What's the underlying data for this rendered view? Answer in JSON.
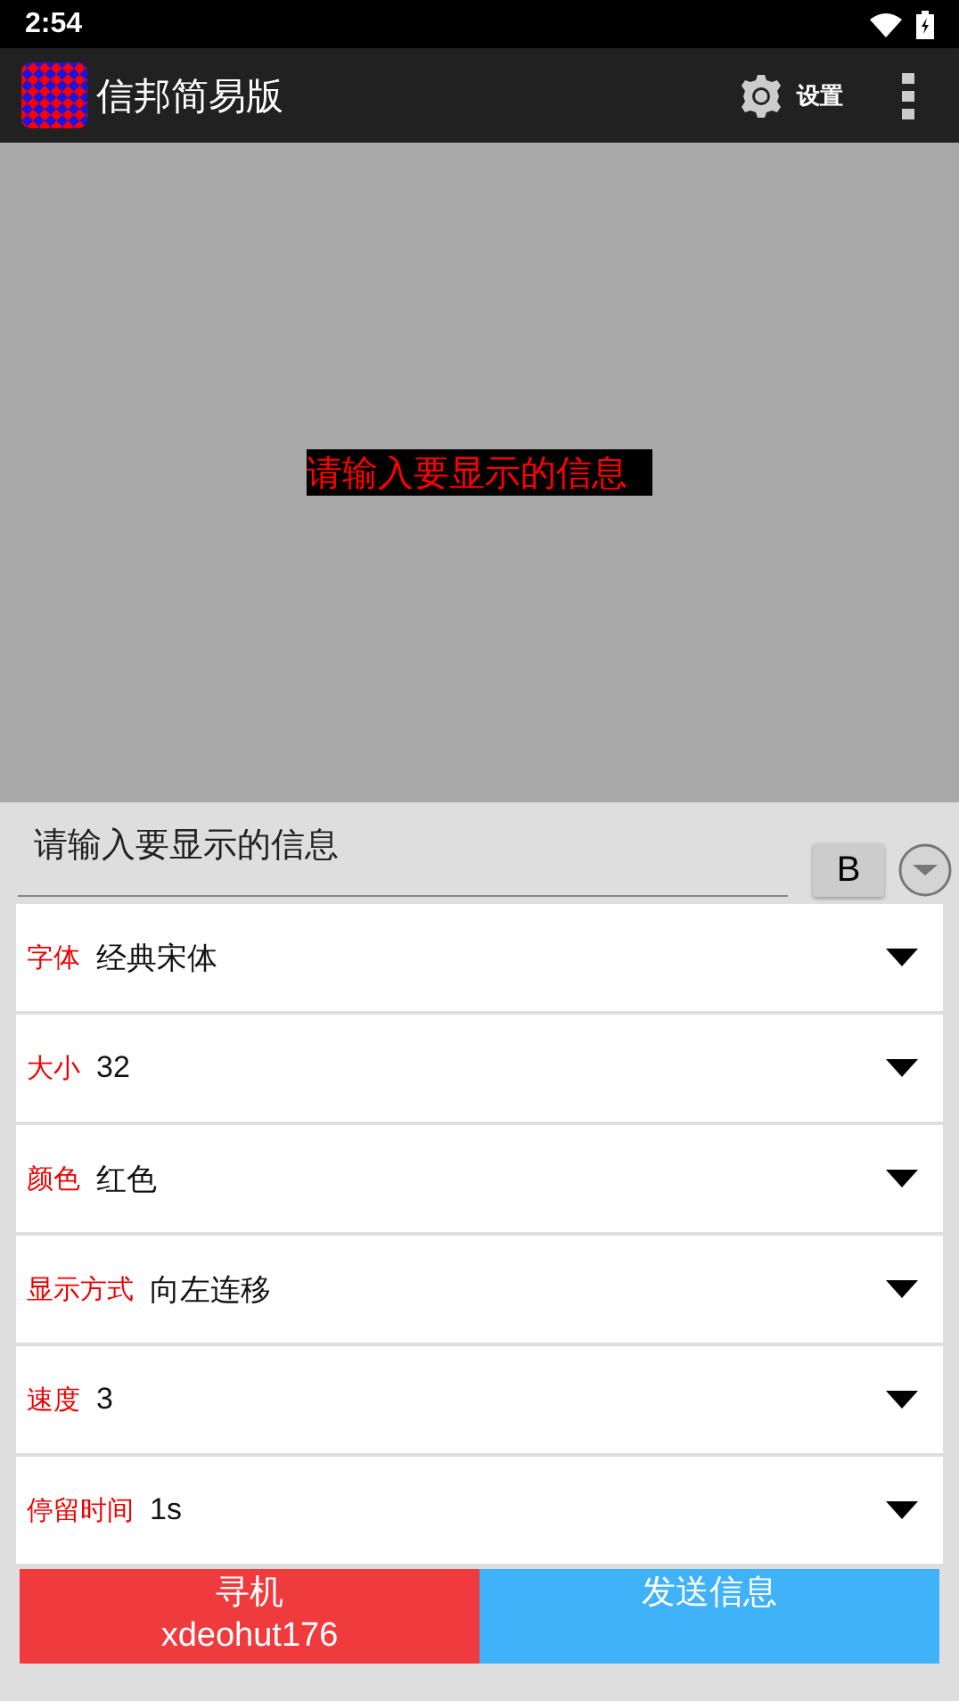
{
  "status_bar": {
    "time": "2:54"
  },
  "app_bar": {
    "title": "信邦简易版",
    "settings_label": "设置"
  },
  "preview": {
    "text": "请输入要显示的信息"
  },
  "message_input": {
    "value": "请输入要显示的信息"
  },
  "bold_button": {
    "label": "B",
    "on": false
  },
  "settings": [
    {
      "label": "字体",
      "value": "经典宋体"
    },
    {
      "label": "大小",
      "value": "32"
    },
    {
      "label": "颜色",
      "value": "红色"
    },
    {
      "label": "显示方式",
      "value": "向左连移"
    },
    {
      "label": "速度",
      "value": "3"
    },
    {
      "label": "停留时间",
      "value": "1s"
    }
  ],
  "actions": [
    {
      "label": "寻机",
      "sub": "xdeohut176",
      "color": "#ef3b3e"
    },
    {
      "label": "发送信息",
      "color": "#40b2fa"
    }
  ]
}
